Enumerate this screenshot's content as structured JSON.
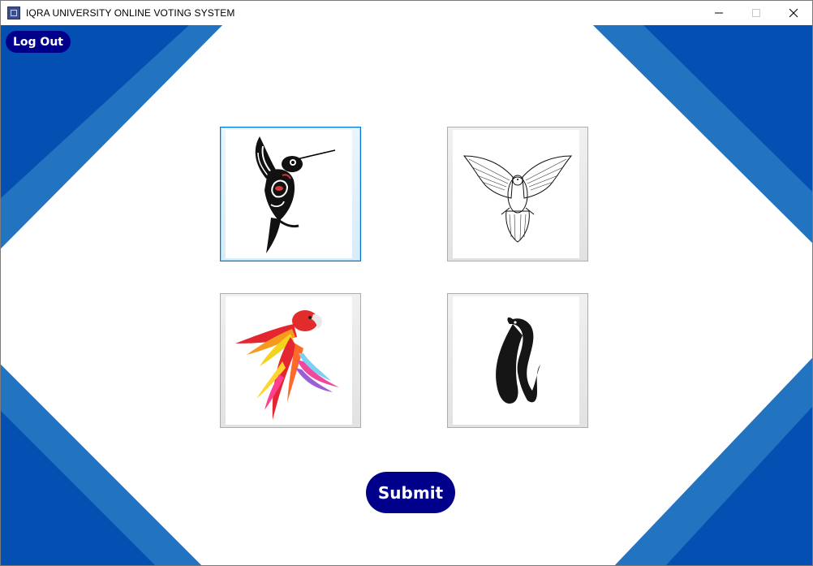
{
  "window": {
    "title": "IQRA UNIVERSITY ONLINE VOTING SYSTEM",
    "controls": [
      "minimize-icon",
      "maximize-icon",
      "close-icon"
    ]
  },
  "toolbar": {
    "logout_label": "Log Out"
  },
  "candidates": [
    {
      "symbol": "hummingbird-icon",
      "selected": true
    },
    {
      "symbol": "dove-icon",
      "selected": false
    },
    {
      "symbol": "parrot-icon",
      "selected": false
    },
    {
      "symbol": "swan-icon",
      "selected": false
    }
  ],
  "actions": {
    "submit_label": "Submit"
  },
  "colors": {
    "primary_button": "#00008b",
    "background_stripe_dark": "#0350b2",
    "background_stripe_light": "#2274c0",
    "selected_border": "#0078d7"
  }
}
